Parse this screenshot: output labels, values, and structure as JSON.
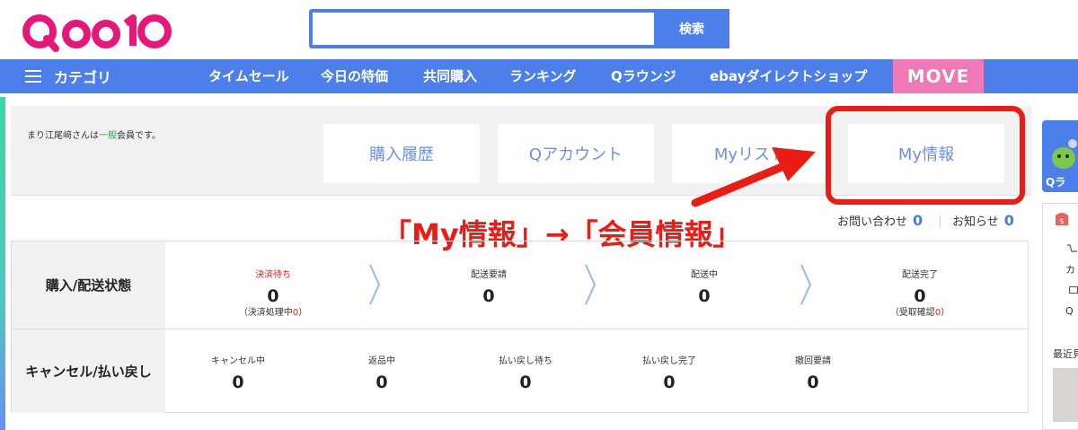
{
  "header": {
    "logo_text": "Qoo10",
    "search": {
      "value": "",
      "placeholder": "",
      "button_label": "検索"
    }
  },
  "nav": {
    "category_label": "カテゴリ",
    "items": [
      {
        "label": "タイムセール"
      },
      {
        "label": "今日の特価"
      },
      {
        "label": "共同購入"
      },
      {
        "label": "ランキング"
      },
      {
        "label": "Qラウンジ"
      },
      {
        "label": "ebayダイレクトショップ"
      }
    ],
    "move_label": "MOVE"
  },
  "member": {
    "name_text": "まり江尾﨑さんは",
    "grade": "一般",
    "suffix": "会員です。",
    "buttons": [
      {
        "label": "購入履歴"
      },
      {
        "label": "Qアカウント"
      },
      {
        "label": "Myリスト"
      },
      {
        "label": "My情報"
      }
    ]
  },
  "annotation": {
    "text": "「My情報」→「会員情報」"
  },
  "inquiry": {
    "contact_label": "お問い合わせ",
    "contact_count": "0",
    "notice_label": "お知らせ",
    "notice_count": "0"
  },
  "status": {
    "purchase_label": "購入/配送状態",
    "purchase_items": [
      {
        "label": "決済待ち",
        "value": "0",
        "sub_prefix": "（決済処理中",
        "sub_value": "0",
        "sub_suffix": "）"
      },
      {
        "label": "配送要請",
        "value": "0"
      },
      {
        "label": "配送中",
        "value": "0"
      },
      {
        "label": "配送完了",
        "value": "0",
        "sub_prefix": "（受取確認",
        "sub_value": "0",
        "sub_suffix": "）"
      }
    ],
    "cancel_label": "キャンセル/払い戻し",
    "cancel_items": [
      {
        "label": "キャンセル中",
        "value": "0"
      },
      {
        "label": "返品中",
        "value": "0"
      },
      {
        "label": "払い戻し待ち",
        "value": "0"
      },
      {
        "label": "払い戻し完了",
        "value": "0"
      },
      {
        "label": "撤回要請",
        "value": "0"
      }
    ]
  },
  "right_column": {
    "qlounge_label": "Qラ",
    "items": [
      {
        "label": "カ"
      },
      {
        "label": "Q"
      },
      {
        "label": "最近見"
      }
    ]
  },
  "colors": {
    "brand_blue": "#4d7fea",
    "logo_pink": "#e8157a",
    "annotation_red": "#ea1c13",
    "move_pink": "#f07ab8"
  }
}
